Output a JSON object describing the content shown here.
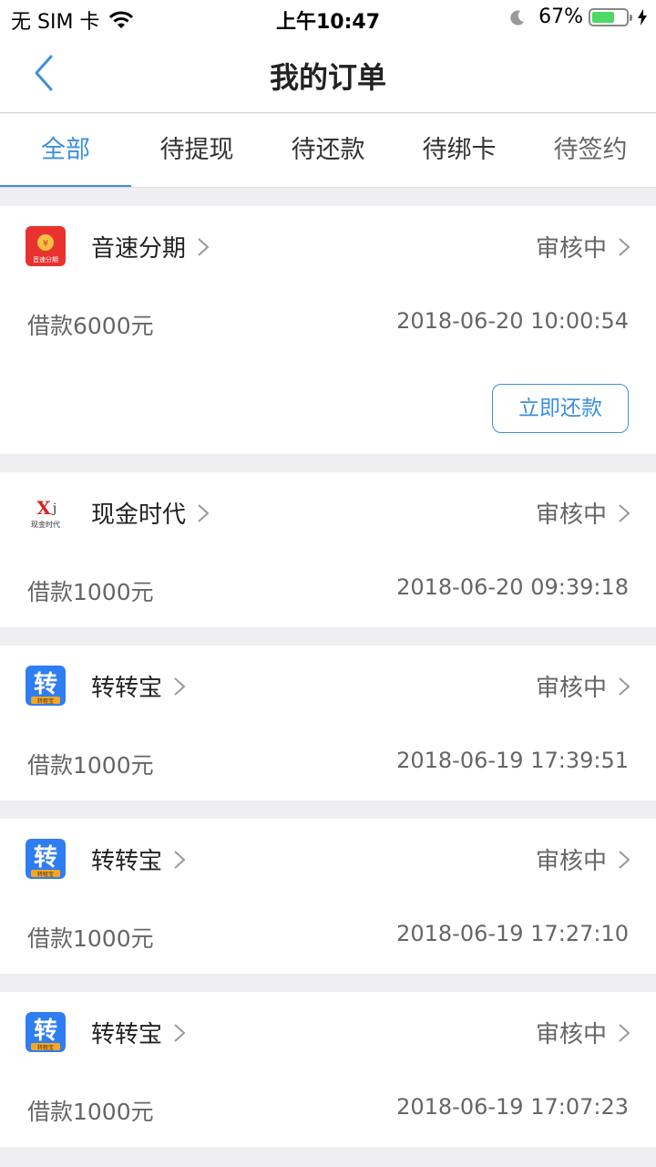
{
  "status_bar": {
    "carrier": "无 SIM 卡",
    "time": "上午10:47",
    "battery": "67%",
    "battery_level": 0.67
  },
  "nav": {
    "title": "我的订单"
  },
  "tabs": [
    {
      "label": "全部",
      "active": true
    },
    {
      "label": "待提现",
      "active": false
    },
    {
      "label": "待还款",
      "active": false
    },
    {
      "label": "待绑卡",
      "active": false
    },
    {
      "label": "待签约",
      "active": false
    }
  ],
  "orders": [
    {
      "merchant": "音速分期",
      "logo_text": "音速分期",
      "status": "审核中",
      "amount": "借款6000元",
      "time": "2018-06-20 10:00:54",
      "action": "立即还款"
    },
    {
      "merchant": "现金时代",
      "logo_text": "现金时代",
      "status": "审核中",
      "amount": "借款1000元",
      "time": "2018-06-20 09:39:18"
    },
    {
      "merchant": "转转宝",
      "logo_text": "转",
      "logo_sub": "转租宝",
      "status": "审核中",
      "amount": "借款1000元",
      "time": "2018-06-19 17:39:51"
    },
    {
      "merchant": "转转宝",
      "logo_text": "转",
      "logo_sub": "转租宝",
      "status": "审核中",
      "amount": "借款1000元",
      "time": "2018-06-19 17:27:10"
    },
    {
      "merchant": "转转宝",
      "logo_text": "转",
      "logo_sub": "转租宝",
      "status": "审核中",
      "amount": "借款1000元",
      "time": "2018-06-19 17:07:23"
    }
  ],
  "colors": {
    "accent": "#3d8fe0",
    "battery_green": "#4cd964",
    "yinsu_red": "#e8322f",
    "zhuan_blue": "#2e7df2",
    "zhuan_orange": "#f6a623"
  }
}
